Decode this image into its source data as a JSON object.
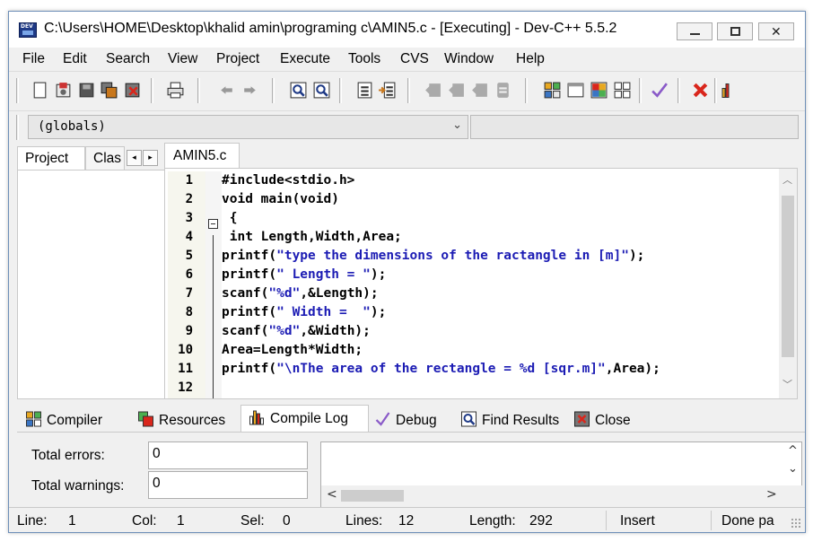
{
  "window": {
    "title": "C:\\Users\\HOME\\Desktop\\khalid amin\\programing c\\AMIN5.c - [Executing] - Dev-C++ 5.5.2",
    "close_glyph": "✕"
  },
  "menu": [
    "File",
    "Edit",
    "Search",
    "View",
    "Project",
    "Execute",
    "Tools",
    "CVS",
    "Window",
    "Help"
  ],
  "globals": {
    "value": "(globals)",
    "chevron": "⌄"
  },
  "left_panel": {
    "tabs": [
      "Project",
      "Clas"
    ],
    "arrow_left": "◂",
    "arrow_right": "▸"
  },
  "editor": {
    "tab": "AMIN5.c",
    "lines": [
      {
        "n": "1",
        "parts": [
          {
            "t": "#include<stdio.h>",
            "c": "plain"
          }
        ]
      },
      {
        "n": "2",
        "parts": [
          {
            "t": "void main(void)",
            "c": "plain"
          }
        ]
      },
      {
        "n": "3",
        "parts": [
          {
            "t": " {",
            "c": "plain"
          }
        ]
      },
      {
        "n": "4",
        "parts": [
          {
            "t": " int Length,Width,Area;",
            "c": "plain"
          }
        ]
      },
      {
        "n": "5",
        "parts": [
          {
            "t": "printf(",
            "c": "plain"
          },
          {
            "t": "\"type the dimensions of the ractangle in [m]\"",
            "c": "str"
          },
          {
            "t": ");",
            "c": "plain"
          }
        ]
      },
      {
        "n": "6",
        "parts": [
          {
            "t": "printf(",
            "c": "plain"
          },
          {
            "t": "\" Length = \"",
            "c": "str"
          },
          {
            "t": ");",
            "c": "plain"
          }
        ]
      },
      {
        "n": "7",
        "parts": [
          {
            "t": "scanf(",
            "c": "plain"
          },
          {
            "t": "\"%d\"",
            "c": "str"
          },
          {
            "t": ",&Length);",
            "c": "plain"
          }
        ]
      },
      {
        "n": "8",
        "parts": [
          {
            "t": "printf(",
            "c": "plain"
          },
          {
            "t": "\" Width =  \"",
            "c": "str"
          },
          {
            "t": ");",
            "c": "plain"
          }
        ]
      },
      {
        "n": "9",
        "parts": [
          {
            "t": "scanf(",
            "c": "plain"
          },
          {
            "t": "\"%d\"",
            "c": "str"
          },
          {
            "t": ",&Width);",
            "c": "plain"
          }
        ]
      },
      {
        "n": "10",
        "parts": [
          {
            "t": "Area=Length*Width;",
            "c": "plain"
          }
        ]
      },
      {
        "n": "11",
        "parts": [
          {
            "t": "printf(",
            "c": "plain"
          },
          {
            "t": "\"\\nThe area of the rectangle = %d [sqr.m]\"",
            "c": "str"
          },
          {
            "t": ",Area);",
            "c": "plain"
          }
        ]
      },
      {
        "n": "12",
        "parts": [
          {
            "t": "",
            "c": "plain"
          }
        ]
      }
    ],
    "scroll_up": "︿",
    "scroll_down": "﹀"
  },
  "bottom_tabs": {
    "compiler": "Compiler",
    "resources": "Resources",
    "compile_log": "Compile Log",
    "debug": "Debug",
    "find_results": "Find Results",
    "close": "Close"
  },
  "compile_log": {
    "total_errors_label": "Total errors:",
    "total_errors_value": "0",
    "total_warnings_label": "Total warnings:",
    "total_warnings_value": "0",
    "scroll_up": "^",
    "scroll_down": "⌄",
    "scroll_left": "<",
    "scroll_right": ">"
  },
  "status": {
    "line_label": "Line:",
    "line_value": "1",
    "col_label": "Col:",
    "col_value": "1",
    "sel_label": "Sel:",
    "sel_value": "0",
    "lines_label": "Lines:",
    "lines_value": "12",
    "length_label": "Length:",
    "length_value": "292",
    "mode": "Insert",
    "message": "Done pa"
  },
  "colors": {
    "string": "#1c1cb4",
    "accent": "#1f3a86",
    "delete_red": "#d9261c",
    "check_purple": "#8a5ac8"
  }
}
